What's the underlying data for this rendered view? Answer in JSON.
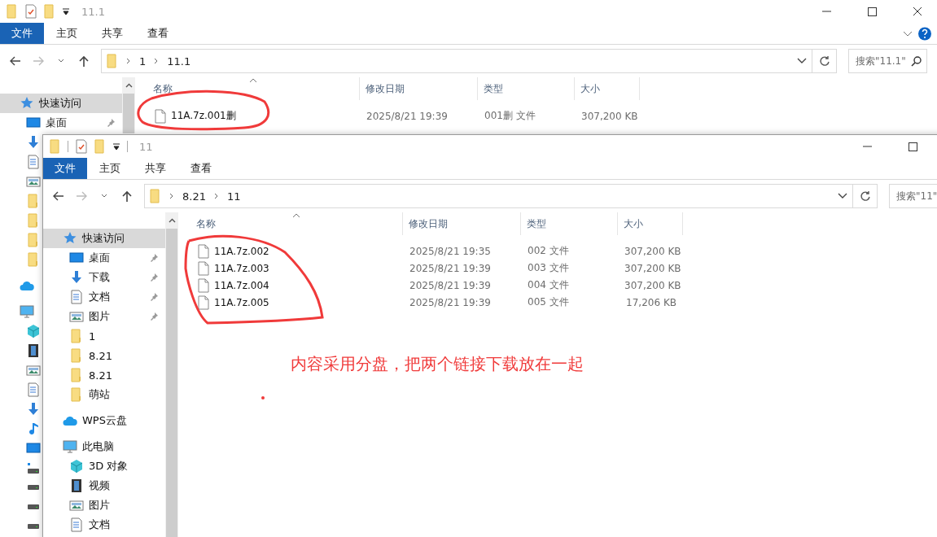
{
  "back_window": {
    "title": "11.1",
    "ribbon_tabs": [
      {
        "label": "文件",
        "kind": "file"
      },
      {
        "label": "主页",
        "kind": "tab"
      },
      {
        "label": "共享",
        "kind": "tab"
      },
      {
        "label": "查看",
        "kind": "tab"
      }
    ],
    "path": [
      "1",
      "11.1"
    ],
    "search": {
      "placeholder": "搜索\"11.1\""
    },
    "sidebar": [
      {
        "label": "快速访问",
        "kind": "quick",
        "selected": true,
        "children": [
          {
            "label": "桌面",
            "kind": "desktop",
            "selected": false,
            "pinned": true
          },
          {
            "kind": "download",
            "selected": false
          },
          {
            "kind": "doc",
            "selected": false
          },
          {
            "kind": "picture",
            "selected": false
          },
          {
            "kind": "folder",
            "selected": false
          },
          {
            "kind": "folder",
            "selected": false
          },
          {
            "kind": "folder",
            "selected": false
          },
          {
            "kind": "folder",
            "selected": false
          }
        ]
      },
      {
        "kind": "cloud",
        "selected": false
      },
      {
        "kind": "pc",
        "selected": false,
        "children": [
          {
            "kind": "cube",
            "selected": false
          },
          {
            "kind": "video",
            "selected": false
          },
          {
            "kind": "picture",
            "selected": false
          },
          {
            "kind": "doc",
            "selected": false
          },
          {
            "kind": "download",
            "selected": false
          },
          {
            "kind": "music",
            "selected": false
          },
          {
            "kind": "desktop",
            "selected": false
          },
          {
            "kind": "drive-win",
            "selected": false
          },
          {
            "kind": "drive",
            "selected": false
          },
          {
            "kind": "drive",
            "selected": false
          },
          {
            "kind": "drive",
            "selected": false
          }
        ]
      }
    ],
    "columns": [
      "名称",
      "修改日期",
      "类型",
      "大小"
    ],
    "files": [
      {
        "name": "11A.7z.001删",
        "modified": "2025/8/21 19:39",
        "type": "001删 文件",
        "size": "307,200 KB"
      }
    ]
  },
  "front_window": {
    "title": "11",
    "ribbon_tabs": [
      {
        "label": "文件",
        "kind": "file"
      },
      {
        "label": "主页",
        "kind": "tab"
      },
      {
        "label": "共享",
        "kind": "tab"
      },
      {
        "label": "查看",
        "kind": "tab"
      }
    ],
    "path": [
      "8.21",
      "11"
    ],
    "search": {
      "placeholder": "搜索\"11\""
    },
    "sidebar": [
      {
        "label": "快速访问",
        "kind": "quick",
        "selected": true,
        "children": [
          {
            "label": "桌面",
            "kind": "desktop",
            "selected": false,
            "pinned": true
          },
          {
            "label": "下载",
            "kind": "download",
            "selected": false,
            "pinned": true
          },
          {
            "label": "文档",
            "kind": "doc",
            "selected": false,
            "pinned": true
          },
          {
            "label": "图片",
            "kind": "picture",
            "selected": false,
            "pinned": true
          },
          {
            "label": "1",
            "kind": "folder",
            "selected": false,
            "pinned": false
          },
          {
            "label": "8.21",
            "kind": "folder",
            "selected": false,
            "pinned": false
          },
          {
            "label": "8.21",
            "kind": "folder",
            "selected": false,
            "pinned": false
          },
          {
            "label": "萌站",
            "kind": "folder",
            "selected": false,
            "pinned": false
          }
        ]
      },
      {
        "label": "WPS云盘",
        "kind": "cloud",
        "selected": false
      },
      {
        "label": "此电脑",
        "kind": "pc",
        "selected": false,
        "children": [
          {
            "label": "3D 对象",
            "kind": "cube",
            "selected": false
          },
          {
            "label": "视频",
            "kind": "video",
            "selected": false
          },
          {
            "label": "图片",
            "kind": "picture",
            "selected": false
          },
          {
            "label": "文档",
            "kind": "doc",
            "selected": false
          }
        ]
      }
    ],
    "columns": [
      "名称",
      "修改日期",
      "类型",
      "大小"
    ],
    "files": [
      {
        "name": "11A.7z.002",
        "modified": "2025/8/21 19:35",
        "type": "002 文件",
        "size": "307,200 KB"
      },
      {
        "name": "11A.7z.003",
        "modified": "2025/8/21 19:39",
        "type": "003 文件",
        "size": "307,200 KB"
      },
      {
        "name": "11A.7z.004",
        "modified": "2025/8/21 19:39",
        "type": "004 文件",
        "size": "307,200 KB"
      },
      {
        "name": "11A.7z.005",
        "modified": "2025/8/21 19:39",
        "type": "005 文件",
        "size": "17,206 KB"
      }
    ]
  },
  "annotation": {
    "note": "内容采用分盘，把两个链接下载放在一起"
  }
}
